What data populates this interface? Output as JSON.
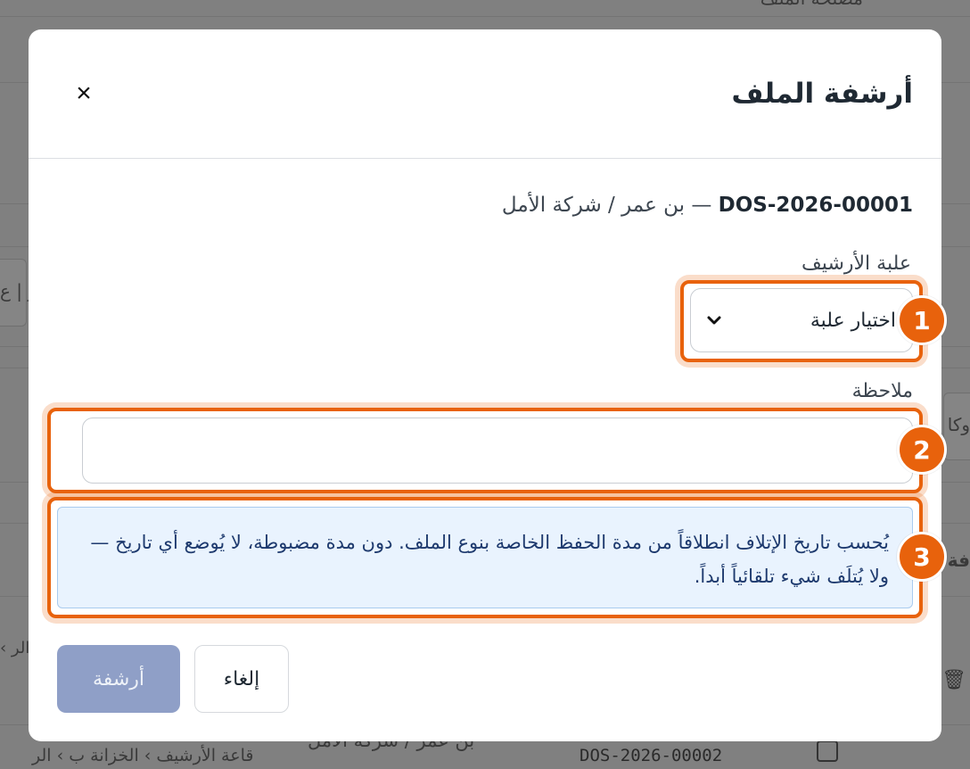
{
  "background": {
    "row_ref": "DOS-2026-00002",
    "row_client": "بن عمر / شركة الأمل",
    "row_location": "قاعة الأرشيف › الخزانة ب › الر",
    "fragment_1": "مصلحة الملف",
    "fragment_2": "ر | ع",
    "fragment_3": "وكا",
    "fragment_4": "فة",
    "fragment_5": "الر ›"
  },
  "modal": {
    "title": "أرشفة الملف",
    "close_label": "×",
    "file_ref": "DOS-2026-00001",
    "file_separator": " — ",
    "file_client": "بن عمر / شركة الأمل",
    "box_label": "علبة الأرشيف",
    "box_select_value": "اختيار علبة",
    "note_label": "ملاحظة",
    "note_value": "",
    "note_placeholder": "",
    "info_text": "يُحسب تاريخ الإتلاف انطلاقاً من مدة الحفظ الخاصة بنوع الملف. دون مدة مضبوطة، لا يُوضع أي تاريخ — ولا يُتلَف شيء تلقائياً أبداً.",
    "archive_button": "أرشفة",
    "cancel_button": "إلغاء"
  },
  "annotations": {
    "badge_1": "1",
    "badge_2": "2",
    "badge_3": "3",
    "accent_color": "#e8620c"
  }
}
